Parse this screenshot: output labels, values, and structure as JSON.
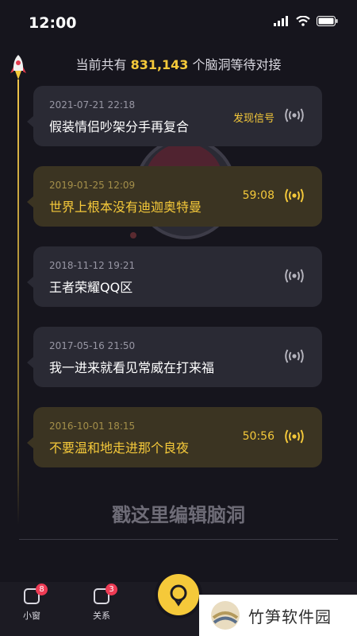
{
  "status_bar": {
    "time": "12:00"
  },
  "header": {
    "count_prefix": "当前共有 ",
    "count_value": "831,143",
    "count_suffix": " 个脑洞等待对接"
  },
  "cards": [
    {
      "date": "2021-07-21  22:18",
      "title": "假装情侣吵架分手再复合",
      "meta": "发现信号",
      "highlighted": false
    },
    {
      "date": "2019-01-25  12:09",
      "title": "世界上根本没有迪迦奥特曼",
      "meta": "59:08",
      "highlighted": true
    },
    {
      "date": "2018-11-12  19:21",
      "title": "王者荣耀QQ区",
      "meta": "",
      "highlighted": false
    },
    {
      "date": "2017-05-16  21:50",
      "title": "我一进来就看见常威在打来福",
      "meta": "",
      "highlighted": false
    },
    {
      "date": "2016-10-01   18:15",
      "title": "不要温和地走进那个良夜",
      "meta": "50:56",
      "highlighted": true
    }
  ],
  "edit_hint": "戳这里编辑脑洞",
  "tabbar": {
    "tabs": [
      {
        "label": "小窗",
        "badge": "8"
      },
      {
        "label": "关系",
        "badge": "3"
      }
    ]
  },
  "watermark": {
    "text": "竹笋软件园"
  },
  "colors": {
    "accent": "#f5c93a",
    "badge": "#ee3b54",
    "background": "#16151d",
    "card": "#2a2a34"
  }
}
